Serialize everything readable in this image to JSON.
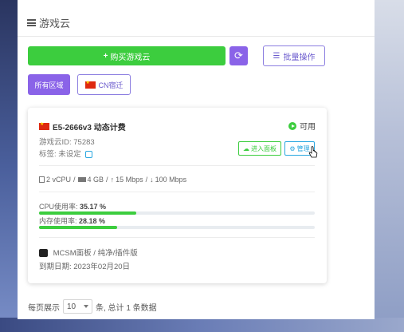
{
  "header": {
    "title": "游戏云"
  },
  "toolbar": {
    "buy_label": "购买游戏云",
    "batch_label": "批量操作"
  },
  "filters": {
    "all_label": "所有区域",
    "region_label": "CN宿迁"
  },
  "server": {
    "name": "E5-2666v3 动态计费",
    "status": "可用",
    "id_label": "游戏云ID: 75283",
    "tag_label": "标签: 未设定",
    "panel_button": "进入面板",
    "manage_button": "管理",
    "cpu": "2 vCPU",
    "memory": "4 GB",
    "upload": "15 Mbps",
    "download": "100 Mbps",
    "cpu_usage_label": "CPU使用率: ",
    "cpu_usage_value": "35.17 %",
    "cpu_usage_fraction": 0.3517,
    "mem_usage_label": "内存使用率: ",
    "mem_usage_value": "28.18 %",
    "mem_usage_fraction": 0.2818,
    "image_label": "MCSM面板 / 纯净/插件版",
    "expiry_label": "到期日期: 2023年02月20日"
  },
  "pagination": {
    "per_page_prefix": "每页展示",
    "per_page_value": "10",
    "summary": "条, 总计 1 条数据"
  },
  "colors": {
    "green": "#3ccd3e",
    "purple": "#8a63e8",
    "blue": "#2aa7e0"
  }
}
